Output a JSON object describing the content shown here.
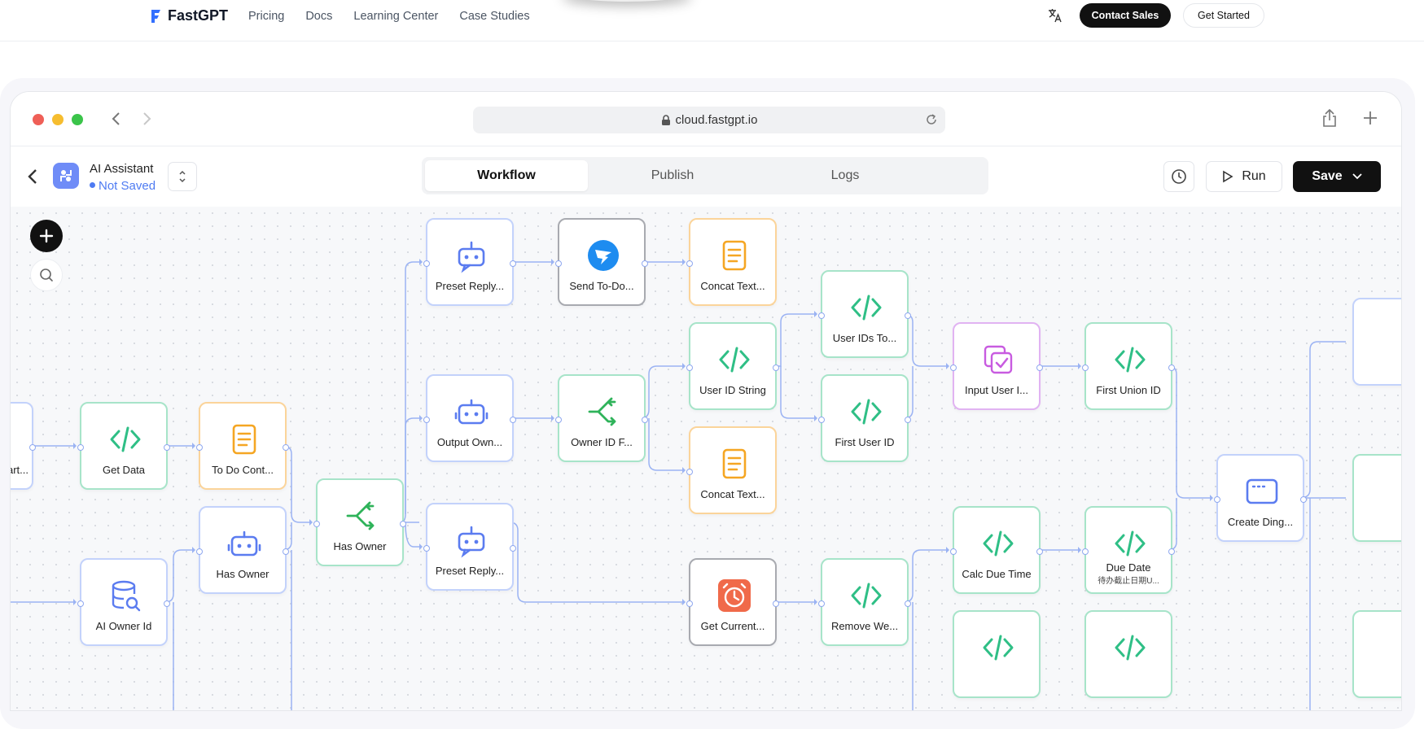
{
  "site_nav": {
    "logo_text": "FastGPT",
    "links": [
      "Pricing",
      "Docs",
      "Learning Center",
      "Case Studies"
    ],
    "contact_sales": "Contact Sales",
    "get_started": "Get Started"
  },
  "browser": {
    "url": "cloud.fastgpt.io"
  },
  "app": {
    "name": "AI Assistant",
    "status": "Not Saved",
    "tabs": [
      "Workflow",
      "Publish",
      "Logs"
    ],
    "active_tab": "Workflow",
    "run_label": "Run",
    "save_label": "Save"
  },
  "workflow": {
    "nodes": [
      {
        "id": "n0",
        "label": "Start...",
        "icon": "chat-icon"
      },
      {
        "id": "n1",
        "label": "Get Data",
        "icon": "code-icon"
      },
      {
        "id": "n2",
        "label": "To Do Cont...",
        "icon": "text-doc-icon"
      },
      {
        "id": "n3",
        "label": "Has Owner",
        "icon": "robot-icon"
      },
      {
        "id": "n4",
        "label": "AI Owner Id",
        "icon": "database-search-icon"
      },
      {
        "id": "n5",
        "label": "Has Owner",
        "icon": "branch-icon"
      },
      {
        "id": "n6",
        "label": "Preset Reply...",
        "icon": "robot-icon"
      },
      {
        "id": "n7",
        "label": "Output Own...",
        "icon": "robot-icon"
      },
      {
        "id": "n8",
        "label": "Preset Reply...",
        "icon": "robot-icon"
      },
      {
        "id": "n9",
        "label": "Send To-Do...",
        "icon": "dingtalk-icon"
      },
      {
        "id": "n10",
        "label": "Owner ID F...",
        "icon": "branch-icon"
      },
      {
        "id": "n11",
        "label": "Concat Text...",
        "icon": "text-doc-icon"
      },
      {
        "id": "n12",
        "label": "User ID String",
        "icon": "code-icon"
      },
      {
        "id": "n13",
        "label": "Concat Text...",
        "icon": "text-doc-icon"
      },
      {
        "id": "n14",
        "label": "Get Current...",
        "icon": "alarm-icon"
      },
      {
        "id": "n15",
        "label": "User IDs To...",
        "icon": "code-icon"
      },
      {
        "id": "n16",
        "label": "First User ID",
        "icon": "code-icon"
      },
      {
        "id": "n17",
        "label": "Remove We...",
        "icon": "code-icon"
      },
      {
        "id": "n18",
        "label": "Input User I...",
        "icon": "checkbox-icon"
      },
      {
        "id": "n19",
        "label": "Calc Due Time",
        "icon": "code-icon"
      },
      {
        "id": "n20",
        "label": "First Union ID",
        "icon": "code-icon"
      },
      {
        "id": "n21",
        "label": "Due Date",
        "sub": "待办截止日期U...",
        "icon": "code-icon"
      },
      {
        "id": "n22",
        "label": "Create Ding...",
        "icon": "window-icon"
      }
    ]
  },
  "colors": {
    "code": "#2fbf86",
    "text": "#f5a623",
    "robot": "#5b7cf0",
    "branch": "#2fb35a",
    "purple": "#c85be0",
    "dingtalk": "#1e8cf0",
    "alarm": "#f06a4a",
    "edge": "#9bb3f3"
  }
}
